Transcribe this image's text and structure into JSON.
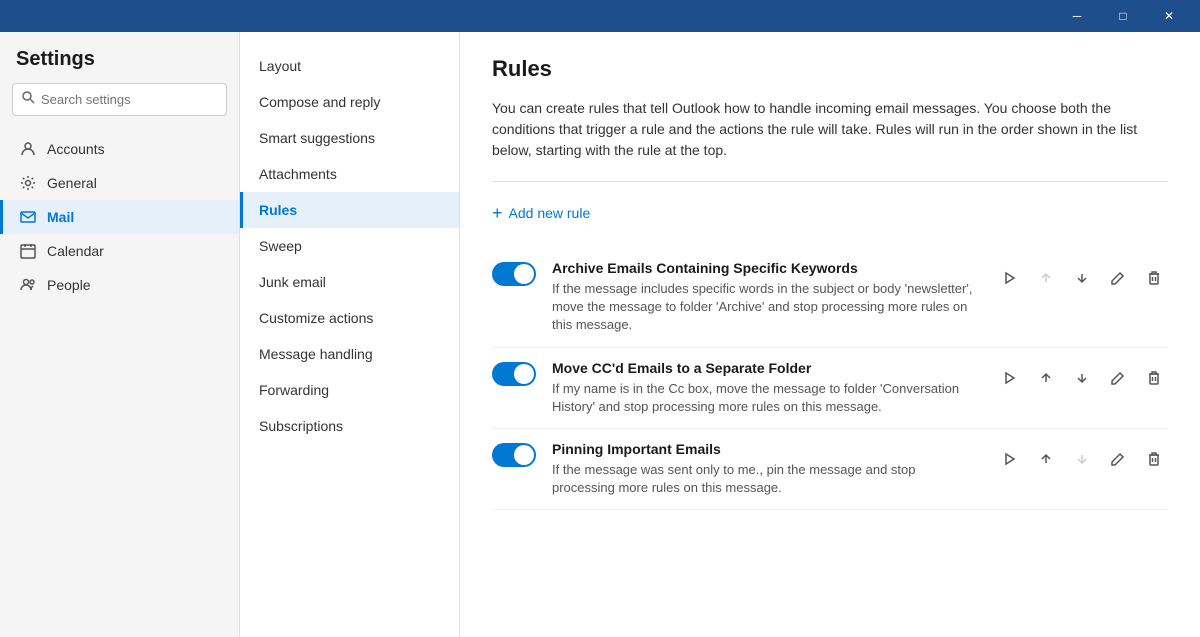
{
  "titlebar": {
    "minimize_label": "─",
    "maximize_label": "□",
    "close_label": "✕"
  },
  "sidebar": {
    "title": "Settings",
    "search_placeholder": "Search settings",
    "nav_items": [
      {
        "id": "accounts",
        "label": "Accounts",
        "icon": "person"
      },
      {
        "id": "general",
        "label": "General",
        "icon": "gear"
      },
      {
        "id": "mail",
        "label": "Mail",
        "icon": "mail",
        "active": true
      },
      {
        "id": "calendar",
        "label": "Calendar",
        "icon": "calendar"
      },
      {
        "id": "people",
        "label": "People",
        "icon": "people"
      }
    ]
  },
  "mid_panel": {
    "items": [
      {
        "id": "layout",
        "label": "Layout"
      },
      {
        "id": "compose",
        "label": "Compose and reply"
      },
      {
        "id": "smart",
        "label": "Smart suggestions"
      },
      {
        "id": "attachments",
        "label": "Attachments"
      },
      {
        "id": "rules",
        "label": "Rules",
        "active": true
      },
      {
        "id": "sweep",
        "label": "Sweep"
      },
      {
        "id": "junk",
        "label": "Junk email"
      },
      {
        "id": "customize",
        "label": "Customize actions"
      },
      {
        "id": "message",
        "label": "Message handling"
      },
      {
        "id": "forwarding",
        "label": "Forwarding"
      },
      {
        "id": "subscriptions",
        "label": "Subscriptions"
      }
    ]
  },
  "main": {
    "title": "Rules",
    "description": "You can create rules that tell Outlook how to handle incoming email messages. You choose both the conditions that trigger a rule and the actions the rule will take. Rules will run in the order shown in the list below, starting with the rule at the top.",
    "add_rule_label": "Add new rule",
    "rules": [
      {
        "id": "rule1",
        "title": "Archive Emails Containing Specific Keywords",
        "description": "If the message includes specific words in the subject or body 'newsletter', move the message to folder 'Archive' and stop processing more rules on this message.",
        "enabled": true,
        "can_move_up": false,
        "can_move_down": true
      },
      {
        "id": "rule2",
        "title": "Move CC'd Emails to a Separate Folder",
        "description": "If my name is in the Cc box, move the message to folder 'Conversation History' and stop processing more rules on this message.",
        "enabled": true,
        "can_move_up": true,
        "can_move_down": true
      },
      {
        "id": "rule3",
        "title": "Pinning Important Emails",
        "description": "If the message was sent only to me., pin the message and stop processing more rules on this message.",
        "enabled": true,
        "can_move_up": true,
        "can_move_down": false
      }
    ]
  }
}
